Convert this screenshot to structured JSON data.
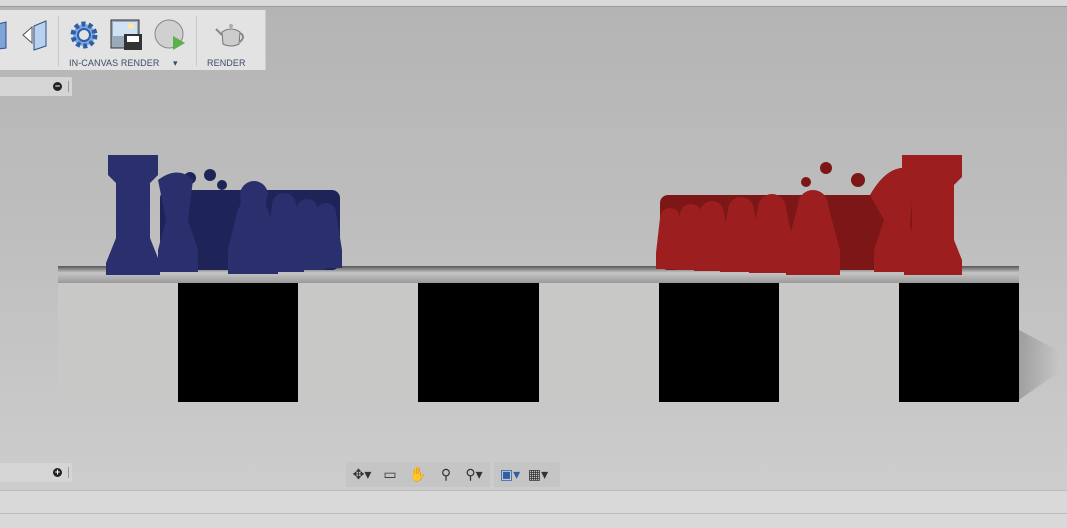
{
  "toolbar": {
    "in_canvas_render_label": "IN-CANVAS RENDER",
    "render_label": "RENDER"
  },
  "panels": {
    "top_button": "−",
    "bottom_button": "+"
  },
  "navbar": {
    "icons": [
      "orbit-icon",
      "look-at-icon",
      "pan-icon",
      "zoom-icon",
      "zoom-window-icon",
      "display-settings-icon",
      "grid-icon"
    ]
  },
  "colors": {
    "blue_pieces": "#2a2f6e",
    "red_pieces": "#9c1e1e",
    "light_square": "#c8c8c6",
    "dark_square": "#000000"
  },
  "board": {
    "squares": [
      "light",
      "dark",
      "light",
      "dark",
      "light",
      "dark",
      "light",
      "dark"
    ]
  }
}
